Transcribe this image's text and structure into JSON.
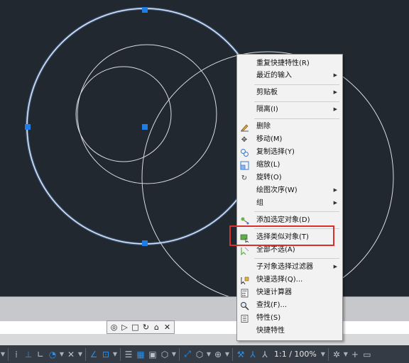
{
  "context_menu": {
    "items": [
      {
        "label": "重复快捷特性(R)",
        "icon": "",
        "submenu": false
      },
      {
        "label": "最近的输入",
        "icon": "",
        "submenu": true
      },
      {
        "label": "剪贴板",
        "icon": "",
        "submenu": true
      },
      {
        "label": "隔离(I)",
        "icon": "",
        "submenu": true
      },
      {
        "label": "删除",
        "icon": "eraser-icon",
        "submenu": false
      },
      {
        "label": "移动(M)",
        "icon": "move-icon",
        "submenu": false
      },
      {
        "label": "复制选择(Y)",
        "icon": "copy-icon",
        "submenu": false
      },
      {
        "label": "缩放(L)",
        "icon": "scale-icon",
        "submenu": false
      },
      {
        "label": "旋转(O)",
        "icon": "rotate-icon",
        "submenu": false
      },
      {
        "label": "绘图次序(W)",
        "icon": "",
        "submenu": true
      },
      {
        "label": "组",
        "icon": "",
        "submenu": true
      },
      {
        "label": "添加选定对象(D)",
        "icon": "add-selected-icon",
        "submenu": false
      },
      {
        "label": "选择类似对象(T)",
        "icon": "select-similar-icon",
        "submenu": false
      },
      {
        "label": "全部不选(A)",
        "icon": "deselect-all-icon",
        "submenu": false
      },
      {
        "label": "子对象选择过滤器",
        "icon": "",
        "submenu": true
      },
      {
        "label": "快速选择(Q)...",
        "icon": "quick-select-icon",
        "submenu": false
      },
      {
        "label": "快速计算器",
        "icon": "calculator-icon",
        "submenu": false
      },
      {
        "label": "查找(F)...",
        "icon": "find-icon",
        "submenu": false
      },
      {
        "label": "特性(S)",
        "icon": "properties-icon",
        "submenu": false
      },
      {
        "label": "快捷特性",
        "icon": "",
        "submenu": false
      }
    ]
  },
  "status_bar": {
    "annotation_scale": "1:1 / 100%"
  },
  "colors": {
    "canvas_bg": "#212830",
    "selection_highlight": "#6aa6ff",
    "grip": "#1e7ee6",
    "highlight_box": "#d9302c"
  }
}
